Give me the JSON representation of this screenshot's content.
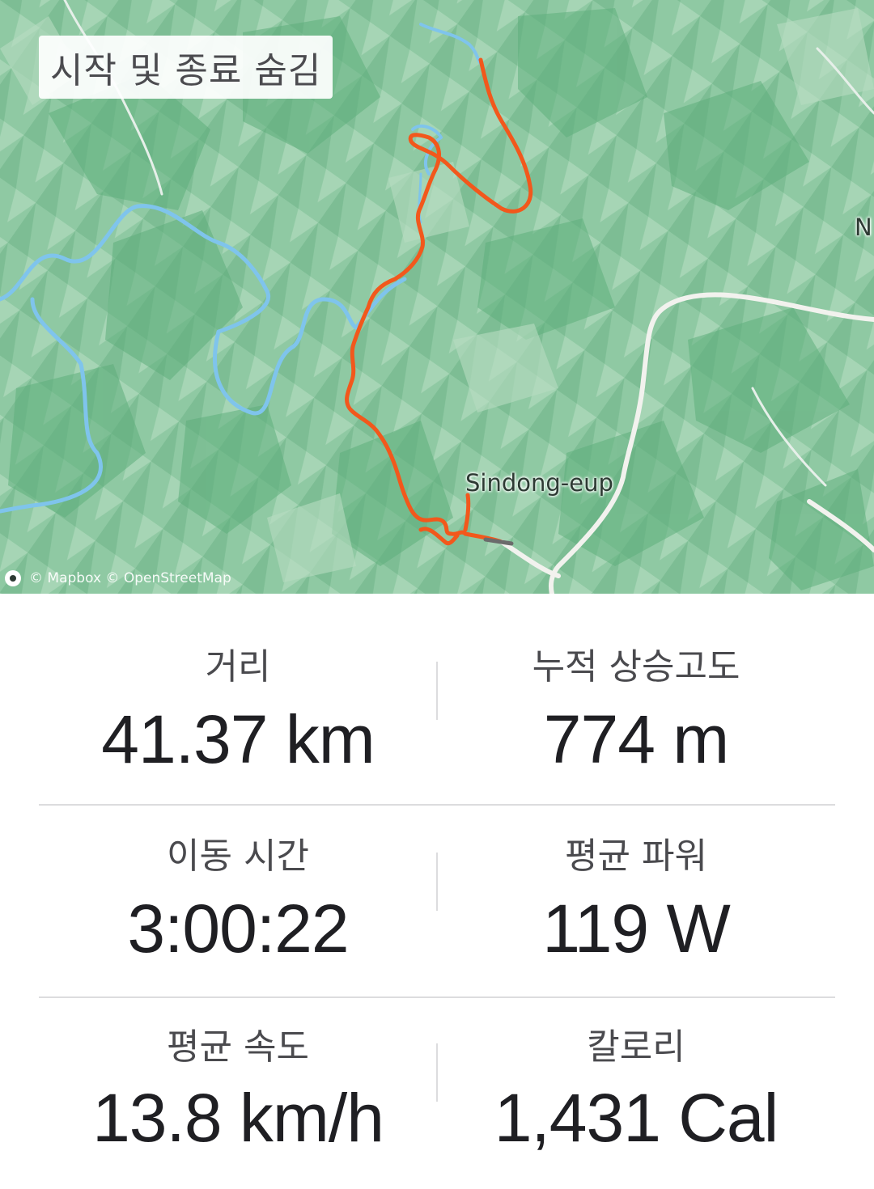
{
  "map": {
    "privacy_label": "시작 및 종료 숨김",
    "place_label": "Sindong-eup",
    "edge_label": "N",
    "attribution": "© Mapbox © OpenStreetMap",
    "colors": {
      "terrain_base": "#8fc9a3",
      "terrain_dark": "#5fae7c",
      "river": "#7fc4ec",
      "road": "#f2f2ee",
      "route": "#f2581c"
    }
  },
  "stats": [
    {
      "label": "거리",
      "value": "41.37 km"
    },
    {
      "label": "누적 상승고도",
      "value": "774 m"
    },
    {
      "label": "이동 시간",
      "value": "3:00:22"
    },
    {
      "label": "평균 파워",
      "value": "119 W"
    },
    {
      "label": "평균 속도",
      "value": "13.8 km/h"
    },
    {
      "label": "칼로리",
      "value": "1,431 Cal"
    }
  ]
}
